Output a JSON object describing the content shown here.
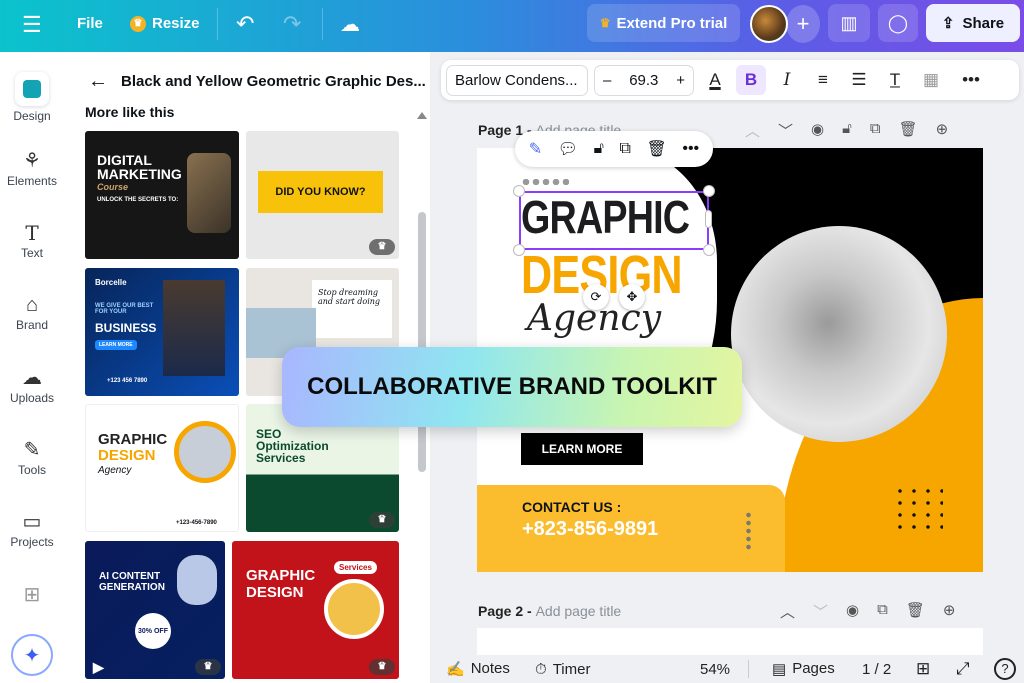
{
  "topbar": {
    "menu_icon": "hamburger-icon",
    "file": "File",
    "resize": "Resize",
    "extend_pro": "Extend Pro trial",
    "share": "Share"
  },
  "rail": {
    "items": [
      {
        "label": "Design"
      },
      {
        "label": "Elements"
      },
      {
        "label": "Text"
      },
      {
        "label": "Brand"
      },
      {
        "label": "Uploads"
      },
      {
        "label": "Tools"
      },
      {
        "label": "Projects"
      }
    ]
  },
  "panel": {
    "title": "Black and Yellow Geometric Graphic Des...",
    "section": "More like this",
    "templates": [
      {
        "title": "DIGITAL MARKETING",
        "sub": "Course",
        "extra": "UNLOCK THE SECRETS TO:"
      },
      {
        "title": "DID YOU KNOW?"
      },
      {
        "title": "BUSINESS",
        "brand": "Borcelle",
        "sub": "WE GIVE OUR BEST FOR YOUR",
        "cta": "LEARN MORE",
        "phone": "+123 456 7890"
      },
      {
        "title": "Stop dreaming and start doing"
      },
      {
        "title": "GRAPHIC",
        "title2": "DESIGN",
        "sub": "Agency",
        "phone": "+123-456-7890"
      },
      {
        "title": "SEO Optimization Services"
      },
      {
        "title": "AI CONTENT GENERATION",
        "badge": "30% OFF"
      },
      {
        "title": "GRAPHIC DESIGN",
        "badge": "Services"
      }
    ]
  },
  "format_toolbar": {
    "font": "Barlow Condens...",
    "size": "69.3",
    "minus": "–",
    "plus": "+",
    "bold": "B",
    "italic": "I"
  },
  "pages": [
    {
      "label": "Page 1 - ",
      "placeholder": "Add page title"
    },
    {
      "label": "Page 2 - ",
      "placeholder": "Add page title"
    }
  ],
  "design": {
    "line1": "GRAPHIC",
    "line2": "DESIGN",
    "line3": "Agency",
    "cta": "LEARN MORE",
    "contact_label": "CONTACT US :",
    "phone": "+823-856-9891"
  },
  "overlay": {
    "text": "COLLABORATIVE BRAND TOOLKIT"
  },
  "bottombar": {
    "notes": "Notes",
    "timer": "Timer",
    "zoom": "54%",
    "pages": "Pages",
    "page_count": "1 / 2"
  },
  "colors": {
    "accent": "#8b3dff",
    "yellow": "#f7a600",
    "canva_teal": "#0bc3cc"
  }
}
